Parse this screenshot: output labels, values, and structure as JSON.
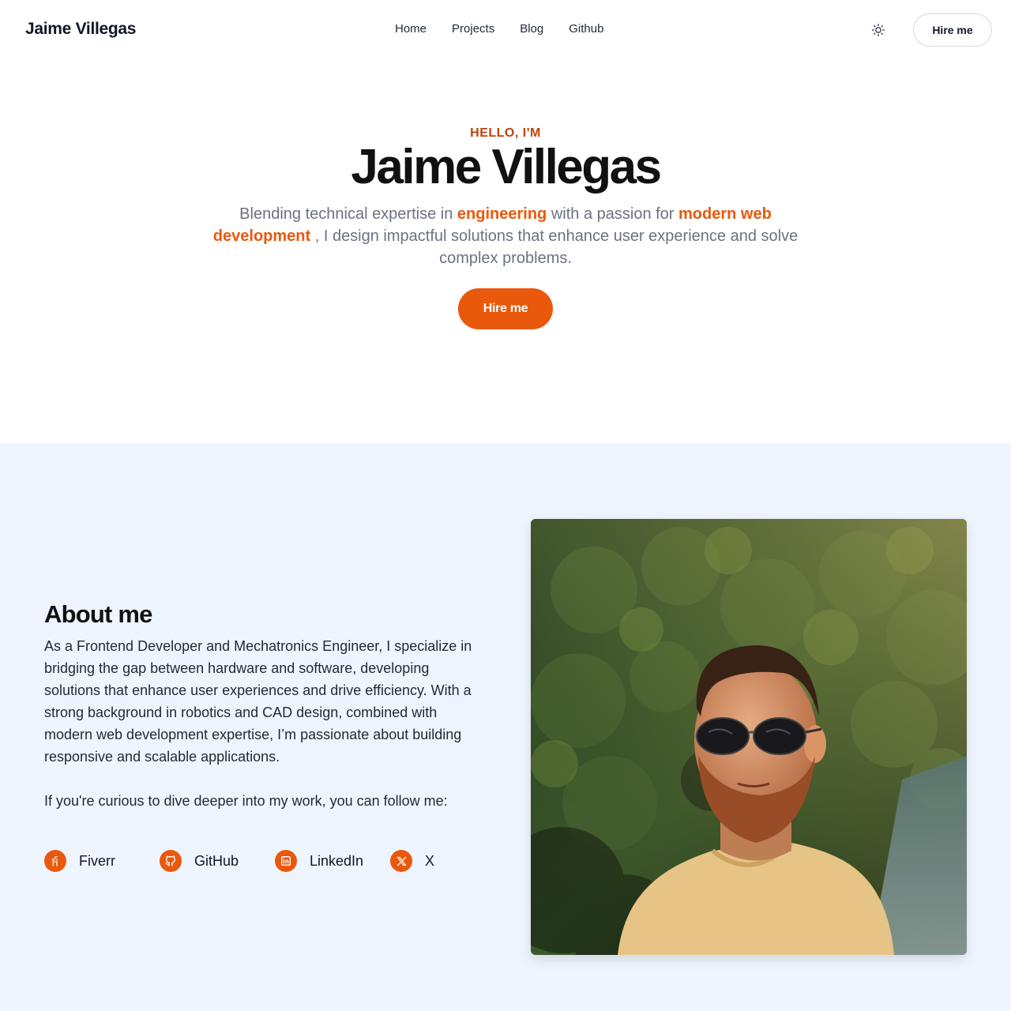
{
  "header": {
    "brand": "Jaime Villegas",
    "nav": [
      "Home",
      "Projects",
      "Blog",
      "Github"
    ],
    "theme_icon": "sun-icon",
    "hire_label": "Hire me"
  },
  "hero": {
    "greeting": "HELLO, I'M",
    "name": "Jaime Villegas",
    "desc_part1": "Blending technical expertise in ",
    "desc_highlight1": "engineering",
    "desc_part2": " with a passion for ",
    "desc_highlight2": "modern web development",
    "desc_part3": " , I design impactful solutions that enhance user experience and solve complex problems.",
    "cta_label": "Hire me",
    "accent_color": "#ea580c"
  },
  "about": {
    "title": "About me",
    "paragraph": "As a Frontend Developer and Mechatronics Engineer, I specialize in bridging the gap between hardware and software, developing solutions that enhance user experiences and drive efficiency. With a strong background in robotics and CAD design, combined with modern web development expertise, I’m passionate about building responsive and scalable applications.",
    "follow": "If you're curious to dive deeper into my work, you can follow me:",
    "socials": [
      {
        "label": "Fiverr",
        "icon": "fiverr-icon"
      },
      {
        "label": "GitHub",
        "icon": "github-icon"
      },
      {
        "label": "LinkedIn",
        "icon": "linkedin-icon"
      },
      {
        "label": "X",
        "icon": "x-icon"
      }
    ],
    "background_color": "#eef5fe"
  }
}
